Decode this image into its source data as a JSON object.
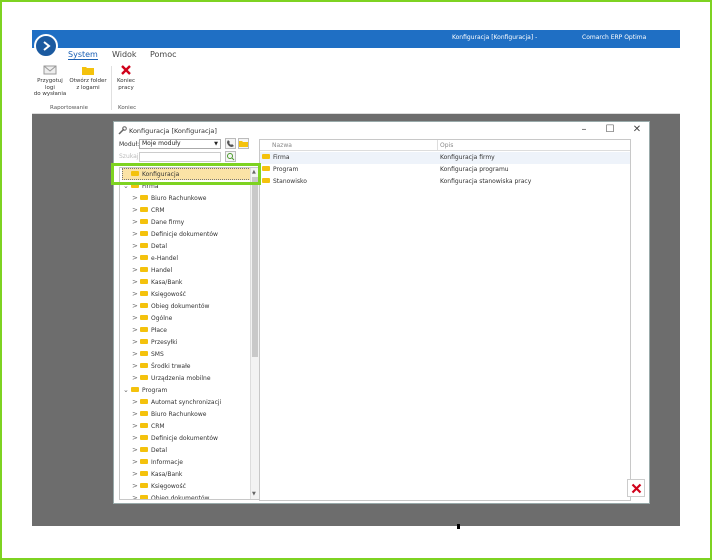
{
  "window": {
    "title": "Konfiguracja [Konfiguracja] -",
    "brand": "Comarch ERP Optima"
  },
  "ribbon_tabs": [
    {
      "label": "System",
      "active": true
    },
    {
      "label": "Widok",
      "active": false
    },
    {
      "label": "Pomoc",
      "active": false
    }
  ],
  "ribbon": {
    "btn_logs_line1": "Przygotuj logi",
    "btn_logs_line2": "do wysłania",
    "btn_folder_line1": "Otwórz folder",
    "btn_folder_line2": "z logami",
    "btn_close_line1": "Koniec",
    "btn_close_line2": "pracy",
    "group_reports": "Raportowanie",
    "group_end": "Koniec"
  },
  "dialog": {
    "title": "Konfiguracja [Konfiguracja]",
    "minimize": "–",
    "maximize": "☐",
    "close": "✕",
    "module_label": "Moduł:",
    "module_value": "Moje moduły",
    "search_label": "Szukaj:"
  },
  "tree": [
    {
      "label": "Konfiguracja",
      "indent": 0,
      "chev": "",
      "selected": true
    },
    {
      "label": "Firma",
      "indent": 1,
      "chev": "⌄"
    },
    {
      "label": "Biuro Rachunkowe",
      "indent": 2,
      "chev": ">"
    },
    {
      "label": "CRM",
      "indent": 2,
      "chev": ">"
    },
    {
      "label": "Dane firmy",
      "indent": 2,
      "chev": ">"
    },
    {
      "label": "Definicje dokumentów",
      "indent": 2,
      "chev": ">"
    },
    {
      "label": "Detal",
      "indent": 2,
      "chev": ">"
    },
    {
      "label": "e-Handel",
      "indent": 2,
      "chev": ">"
    },
    {
      "label": "Handel",
      "indent": 2,
      "chev": ">"
    },
    {
      "label": "Kasa/Bank",
      "indent": 2,
      "chev": ">"
    },
    {
      "label": "Księgowość",
      "indent": 2,
      "chev": ">"
    },
    {
      "label": "Obieg dokumentów",
      "indent": 2,
      "chev": ">"
    },
    {
      "label": "Ogólne",
      "indent": 2,
      "chev": ">"
    },
    {
      "label": "Płace",
      "indent": 2,
      "chev": ">"
    },
    {
      "label": "Przesyłki",
      "indent": 2,
      "chev": ">"
    },
    {
      "label": "SMS",
      "indent": 2,
      "chev": ">"
    },
    {
      "label": "Środki trwałe",
      "indent": 2,
      "chev": ">"
    },
    {
      "label": "Urządzenia mobilne",
      "indent": 2,
      "chev": ">"
    },
    {
      "label": "Program",
      "indent": 1,
      "chev": "⌄"
    },
    {
      "label": "Automat synchronizacji",
      "indent": 2,
      "chev": ">"
    },
    {
      "label": "Biuro Rachunkowe",
      "indent": 2,
      "chev": ">"
    },
    {
      "label": "CRM",
      "indent": 2,
      "chev": ">"
    },
    {
      "label": "Definicje dokumentów",
      "indent": 2,
      "chev": ">"
    },
    {
      "label": "Detal",
      "indent": 2,
      "chev": ">"
    },
    {
      "label": "Informacje",
      "indent": 2,
      "chev": ">"
    },
    {
      "label": "Kasa/Bank",
      "indent": 2,
      "chev": ">"
    },
    {
      "label": "Księgowość",
      "indent": 2,
      "chev": ">"
    },
    {
      "label": "Obieg dokumentów",
      "indent": 2,
      "chev": ">"
    }
  ],
  "list": {
    "col_name": "Nazwa",
    "col_desc": "Opis",
    "rows": [
      {
        "name": "Firma",
        "desc": "Konfiguracja firmy"
      },
      {
        "name": "Program",
        "desc": "Konfiguracja programu"
      },
      {
        "name": "Stanowisko",
        "desc": "Konfiguracja stanowiska pracy"
      }
    ]
  },
  "colors": {
    "titlebar": "#1f6fc4",
    "highlight": "#7ed321",
    "folder": "#f4c20d",
    "close_red": "#d0021b"
  }
}
